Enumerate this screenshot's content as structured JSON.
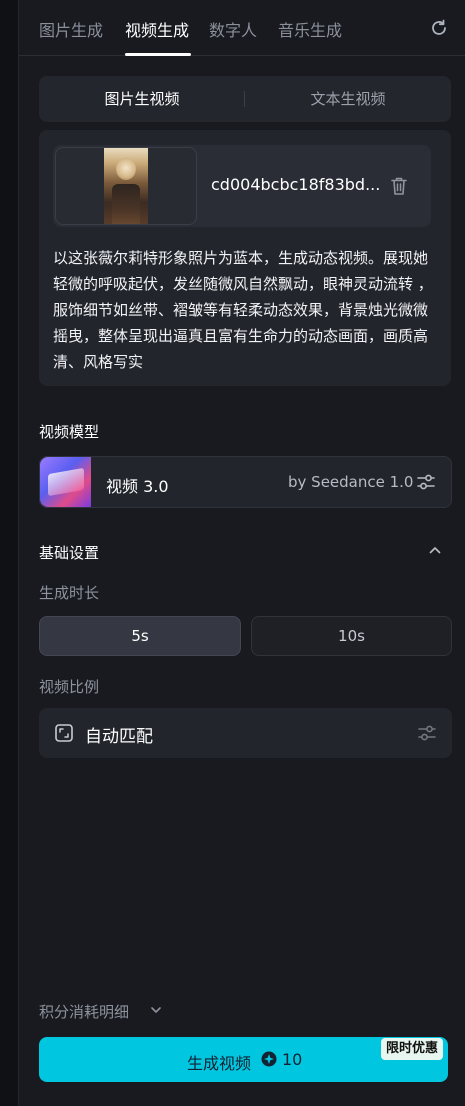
{
  "top_tabs": [
    {
      "label": "图片生成",
      "active": false
    },
    {
      "label": "视频生成",
      "active": true
    },
    {
      "label": "数字人",
      "active": false
    },
    {
      "label": "音乐生成",
      "active": false
    }
  ],
  "mode_switch": {
    "left_label": "图片生视频",
    "right_label": "文本生视频",
    "selected": "图片生视频"
  },
  "prompt_card": {
    "file_name": "cd004bcbc18f83bd...",
    "prompt": "以这张薇尔莉特形象照片为蓝本，生成动态视频。展现她轻微的呼吸起伏，发丝随微风自然飘动，眼神灵动流转 ，服饰细节如丝带、褶皱等有轻柔动态效果，背景烛光微微摇曳，整体呈现出逼真且富有生命力的动态画面，画质高清、风格写实"
  },
  "model": {
    "section_title": "视频模型",
    "name": "视频 3.0",
    "by": "by Seedance 1.0"
  },
  "basic_settings": {
    "title": "基础设置",
    "duration_label": "生成时长",
    "duration_options": [
      "5s",
      "10s"
    ],
    "duration_selected": "5s",
    "ratio_label": "视频比例",
    "ratio_value": "自动匹配"
  },
  "footer": {
    "cost_detail": "积分消耗明细",
    "generate_label": "生成视频",
    "credit_count": "10",
    "promo_badge": "限时优惠"
  },
  "colors": {
    "accent": "#00c6df",
    "panel_bg": "#181a20",
    "card_bg": "#22252c"
  },
  "icons": [
    "refresh-icon",
    "trash-icon",
    "settings-sliders-icon",
    "chevron-up-icon",
    "aspect-ratio-icon",
    "chevron-down-icon",
    "credit-icon"
  ]
}
